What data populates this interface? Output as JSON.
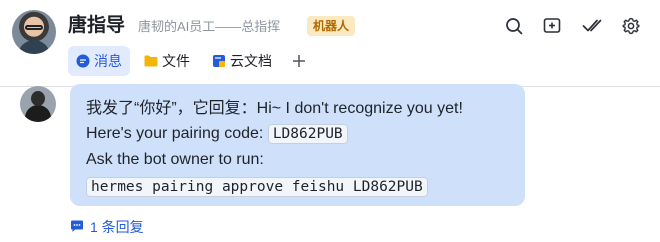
{
  "header": {
    "chat_name": "唐指导",
    "subtitle": "唐韧的AI员工——总指挥",
    "badge": "机器人",
    "icons": [
      "search-icon",
      "add-member-icon",
      "check-double-icon",
      "gear-icon"
    ]
  },
  "tabs": [
    {
      "label": "消息",
      "icon": "chat-bubble-icon",
      "active": true
    },
    {
      "label": "文件",
      "icon": "folder-icon",
      "active": false
    },
    {
      "label": "云文档",
      "icon": "doc-icon",
      "active": false
    }
  ],
  "message": {
    "line1": "我发了“你好”，它回复：Hi~ I don't recognize you yet!",
    "line2_prefix": "Here's your pairing code: ",
    "pairing_code": "LD862PUB",
    "line3": "Ask the bot owner to run:",
    "command": "hermes pairing approve feishu LD862PUB"
  },
  "reply": {
    "count_label": "1 条回复"
  },
  "colors": {
    "accent": "#245bdb",
    "bubble": "#cfe0fb",
    "badge_bg": "#fbe9c2",
    "badge_text": "#b26b00"
  }
}
